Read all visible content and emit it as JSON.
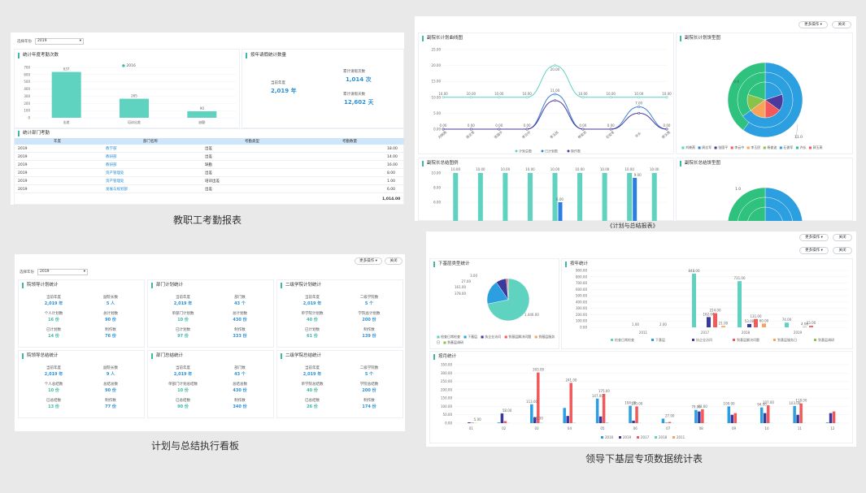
{
  "captions": {
    "p1": "教职工考勤报表",
    "p2": "《计划与总结报表》",
    "p3": "计划与总结执行看板",
    "p4": "领导下基层专项数据统计表"
  },
  "common": {
    "year_label": "选择年份",
    "year_value": "2019",
    "more": "更多操作 ▾",
    "close": "关闭"
  },
  "p1": {
    "sec1": "统计年度考勤次数",
    "sec2": "按年请假统计数量",
    "sec3": "统计部门考勤",
    "legend": "2016",
    "chart_data": {
      "type": "bar",
      "categories": [
        "出差",
        "培训出差",
        "缺勤"
      ],
      "values": [
        637,
        265,
        90
      ],
      "ylim": [
        0,
        700
      ],
      "yticks": [
        "700",
        "600",
        "500",
        "400",
        "300",
        "200",
        "100",
        "0"
      ]
    },
    "current_year_label": "当前年度",
    "current_year": "2,019 年",
    "leave_count_label": "累计请假次数",
    "leave_count": "1,014 次",
    "leave_days_label": "累计请假天数",
    "leave_days": "12,602 天",
    "table_headers": [
      "年度",
      "部门名称",
      "考勤类型",
      "考勤数量"
    ],
    "rows": [
      [
        "2019",
        "教学部",
        "出差",
        "18.00"
      ],
      [
        "2019",
        "教研部",
        "出差",
        "14.00"
      ],
      [
        "2019",
        "教研部",
        "缺勤",
        "16.00"
      ],
      [
        "2019",
        "资产管理处",
        "出差",
        "8.00"
      ],
      [
        "2019",
        "资产管理处",
        "培训出差",
        "1.00"
      ],
      [
        "2019",
        "发展与规划部",
        "出差",
        "6.00"
      ]
    ],
    "total": "1,014.00"
  },
  "p2": {
    "sec1": "副院长计划曲线图",
    "sec2": "副院长计划饼型图",
    "sec3": "副院长总结图例",
    "sec4": "副院长总结饼型图",
    "chart_data": {
      "type": "line",
      "categories": [
        "刘晓燕",
        "周志军",
        "张国平",
        "李云中",
        "李玉民",
        "杨俊波",
        "石俊军",
        "许长",
        "郭玉燕"
      ],
      "ylim": [
        0,
        25
      ],
      "yticks": [
        "25.00",
        "20.00",
        "15.00",
        "10.00",
        "5.00",
        "0.00"
      ],
      "series": [
        {
          "name": "计划总数",
          "values": [
            10,
            10,
            10,
            10,
            20,
            10,
            10,
            10,
            10
          ]
        },
        {
          "name": "已计划数",
          "values": [
            0,
            0,
            0,
            0,
            11,
            0,
            0,
            7,
            0
          ]
        },
        {
          "name": "制作数",
          "values": [
            0,
            0,
            0,
            0,
            9,
            0,
            0,
            5,
            0
          ]
        }
      ],
      "labels_top": [
        "10.00",
        "10.00",
        "10.00",
        "10.00",
        "20.00",
        "10.00",
        "10.00",
        "10.00",
        "10.00"
      ],
      "labels_mid": [
        "11.00",
        "7.00"
      ],
      "labels_zero": [
        "0.00",
        "0.00",
        "0.00",
        "0.00",
        "0.00",
        "0.00",
        "0.00"
      ]
    },
    "pie_legend": [
      "刘晓燕",
      "周志军",
      "张国平",
      "李云中",
      "李玉民",
      "杨俊波",
      "石俊军",
      "许长",
      "郭玉燕"
    ],
    "pie_label_a": "0.0",
    "pie_label_b": "11.0",
    "pie_label_c": "1.0",
    "bar2": {
      "yticks": [
        "10.00",
        "8.00",
        "6.00"
      ],
      "labels": [
        "10.00",
        "10.00",
        "10.00",
        "10.00",
        "10.00",
        "10.00",
        "10.00",
        "10.00",
        "10.00"
      ],
      "mid_labels": [
        "6.00",
        "9.00"
      ]
    }
  },
  "p3": {
    "cards": [
      {
        "title": "院领导计划统计",
        "items": [
          [
            "当前年度",
            "2,019 年"
          ],
          [
            "副院长数",
            "5 人"
          ],
          [
            "个人计划数",
            "16 份"
          ],
          [
            "总计划数",
            "90 份"
          ],
          [
            "已计划数",
            "14 份"
          ],
          [
            "制作数",
            "76 份"
          ]
        ]
      },
      {
        "title": "部门计划统计",
        "items": [
          [
            "当前年度",
            "2,019 年"
          ],
          [
            "部门数",
            "43 个"
          ],
          [
            "单部门计划数",
            "10 份"
          ],
          [
            "总计划数",
            "430 份"
          ],
          [
            "已计划数",
            "97 份"
          ],
          [
            "制作数",
            "333 份"
          ]
        ]
      },
      {
        "title": "二级学院计划统计",
        "items": [
          [
            "当前年度",
            "2,019 年"
          ],
          [
            "二级学院数",
            "5 个"
          ],
          [
            "单学院计划数",
            "40 份"
          ],
          [
            "学院总计划数",
            "200 份"
          ],
          [
            "已计划数",
            "61 份"
          ],
          [
            "制作数",
            "139 份"
          ]
        ]
      },
      {
        "title": "院领导总结统计",
        "items": [
          [
            "当前年度",
            "2,019 年"
          ],
          [
            "副院长数",
            "9 人"
          ],
          [
            "个人总结数",
            "10 份"
          ],
          [
            "总结总数",
            "90 份"
          ],
          [
            "已总结数",
            "13 份"
          ],
          [
            "制作数",
            "77 份"
          ]
        ]
      },
      {
        "title": "部门总结统计",
        "items": [
          [
            "当前年度",
            "2,019 年"
          ],
          [
            "部门数",
            "43 个"
          ],
          [
            "单部门计划总结数",
            "10 份"
          ],
          [
            "总结总数",
            "430 份"
          ],
          [
            "已总结数",
            "90 份"
          ],
          [
            "制作数",
            "340 份"
          ]
        ]
      },
      {
        "title": "二级学院总结统计",
        "items": [
          [
            "当前年度",
            "2,019 年"
          ],
          [
            "二级学院数",
            "5 个"
          ],
          [
            "单学院总结数",
            "40 份"
          ],
          [
            "学院总结数",
            "200 份"
          ],
          [
            "已总结数",
            "26 份"
          ],
          [
            "制作数",
            "174 份"
          ]
        ]
      }
    ]
  },
  "p4": {
    "sec1": "下基层类型统计",
    "sec2": "按年统计",
    "sec3": "按月统计",
    "pie": {
      "labels": [
        "3.00",
        "27.00",
        "161.00",
        "378.00",
        "1,446.00"
      ],
      "legend": [
        "检查日常检查",
        "下基层",
        "执企业访问",
        "到基层解决问题",
        "到基层服务日",
        "到基层调研"
      ]
    },
    "year_chart": {
      "categories": [
        "2011",
        "2017",
        "2018",
        "2019"
      ],
      "yticks": [
        "900.00",
        "800.00",
        "700.00",
        "600.00",
        "500.00",
        "400.00",
        "300.00",
        "200.00",
        "100.00",
        "0.00"
      ],
      "labels": [
        "1.00",
        "2.00",
        "848.00",
        "162.00",
        "224.00",
        "21.00",
        "731.00",
        "53.00",
        "131.00",
        "60.00",
        "74.00",
        "4.00",
        "23.00"
      ]
    },
    "month_chart": {
      "categories": [
        "01",
        "02",
        "03",
        "04",
        "05",
        "06",
        "07",
        "08",
        "09",
        "10",
        "11",
        "12"
      ],
      "yticks": [
        "350.00",
        "300.00",
        "250.00",
        "200.00",
        "150.00",
        "100.00",
        "50.00",
        "0.00"
      ],
      "series": [
        {
          "name": "2016",
          "values": [
            0,
            4,
            113,
            91,
            147,
            104,
            27,
            79,
            100,
            94,
            103,
            4
          ]
        },
        {
          "name": "2019",
          "values": [
            5,
            58,
            35,
            43,
            40,
            15,
            2,
            70,
            50,
            60,
            50,
            60
          ]
        },
        {
          "name": "2017",
          "values": [
            3,
            12,
            303,
            241,
            175,
            100,
            7,
            83,
            60,
            107,
            118,
            70
          ]
        },
        {
          "name": "2018",
          "values": [
            1,
            1,
            2,
            2,
            3,
            1,
            1,
            1,
            1,
            1,
            1,
            1
          ]
        },
        {
          "name": "2011",
          "values": [
            0,
            0,
            0,
            0,
            0,
            0,
            0,
            0,
            0,
            0,
            0,
            0
          ]
        }
      ],
      "labels": [
        "5.00",
        "58.00",
        "13.00",
        "113.00",
        "303.00",
        "241.00",
        "175.00",
        "147.00",
        "104.00",
        "100.00",
        "27.00",
        "79.00",
        "83.00",
        "100.00",
        "94.00",
        "107.00",
        "103.00",
        "118.00"
      ],
      "legend": [
        "2016",
        "2019",
        "2017",
        "2018",
        "2011"
      ]
    }
  },
  "colors": {
    "teal": "#3bb8a6",
    "teal_light": "#5fd3c0",
    "blue": "#2b8fd6",
    "navy": "#3a3a9c",
    "red": "#f2595b",
    "orange": "#f7a35c",
    "green": "#8bc34a",
    "grid": "#eef0f3"
  }
}
